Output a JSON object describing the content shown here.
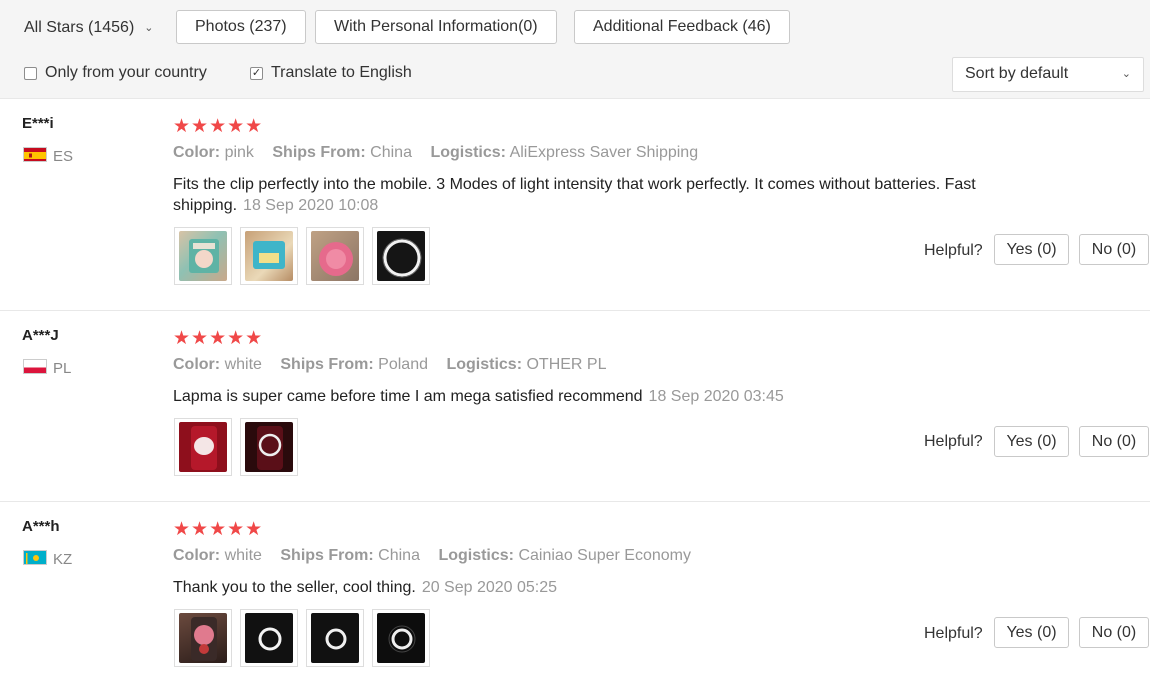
{
  "filters": {
    "all_stars": "All Stars (1456)",
    "photos": "Photos (237)",
    "personal": "With Personal Information(0)",
    "additional": "Additional Feedback (46)",
    "only_country": "Only from your country",
    "translate": "Translate to English",
    "translate_checked": true,
    "only_country_checked": false,
    "sort": "Sort by default"
  },
  "labels": {
    "color": "Color:",
    "ships_from": "Ships From:",
    "logistics": "Logistics:",
    "helpful": "Helpful?",
    "stars": "★★★★★"
  },
  "reviews": [
    {
      "user": "E***i",
      "country": "ES",
      "rating": 5,
      "color": "pink",
      "ships_from": "China",
      "logistics": "AliExpress Saver Shipping",
      "text": "Fits the clip perfectly into the mobile. 3 Modes of light intensity that work perfectly. It comes without batteries. Fast shipping.",
      "date": "18 Sep 2020 10:08",
      "yes": "Yes (0)",
      "no": "No (0)"
    },
    {
      "user": "A***J",
      "country": "PL",
      "rating": 5,
      "color": "white",
      "ships_from": "Poland",
      "logistics": "OTHER PL",
      "text": "Lapma is super came before time I am mega satisfied recommend",
      "date": "18 Sep 2020 03:45",
      "yes": "Yes (0)",
      "no": "No (0)"
    },
    {
      "user": "A***h",
      "country": "KZ",
      "rating": 5,
      "color": "white",
      "ships_from": "China",
      "logistics": "Cainiao Super Economy",
      "text": "Thank you to the seller, cool thing.",
      "date": "20 Sep 2020 05:25",
      "yes": "Yes (0)",
      "no": "No (0)"
    }
  ],
  "colors": {
    "star": "#f04848",
    "muted": "#999999",
    "border": "#c9c9c9"
  }
}
